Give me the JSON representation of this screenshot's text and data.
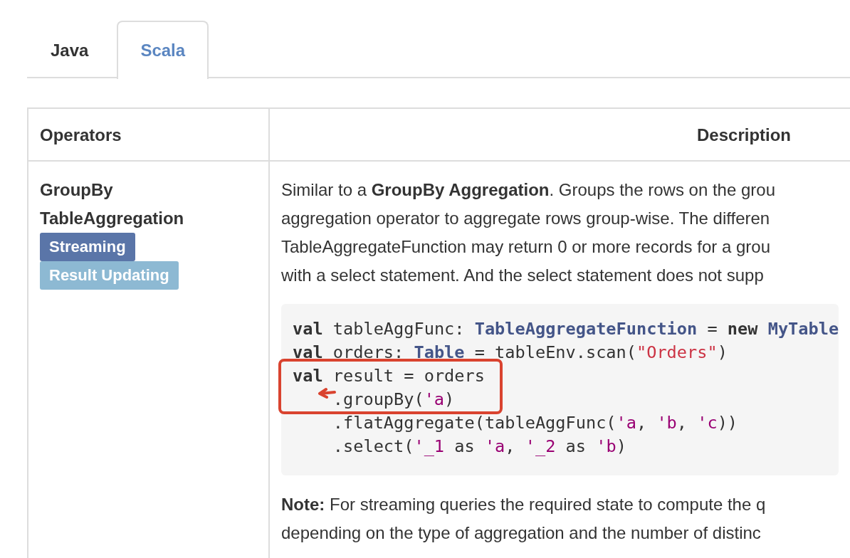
{
  "tabs": [
    {
      "label": "Java",
      "selected": false
    },
    {
      "label": "Scala",
      "selected": true
    }
  ],
  "table": {
    "columns": [
      "Operators",
      "Description"
    ],
    "rows": [
      {
        "operator": [
          "GroupBy",
          "TableAggregation"
        ],
        "tags": [
          {
            "label": "Streaming",
            "color": "#5a75a8"
          },
          {
            "label": "Result Updating",
            "color": "#8db9d3"
          }
        ],
        "description": [
          "Similar to a **GroupBy Aggregation**. Groups the rows on the grou",
          "aggregation operator to aggregate rows group-wise. The differen",
          "TableAggregateFunction may return 0 or more records for a grou",
          "with a select statement. And the select statement does not supp"
        ],
        "code": [
          {
            "indent": false,
            "tokens": [
              {
                "kind": "keyword",
                "text": "val"
              },
              {
                "kind": "plain",
                "text": " tableAggFunc: "
              },
              {
                "kind": "type",
                "text": "TableAggregateFunction"
              },
              {
                "kind": "plain",
                "text": " = "
              },
              {
                "kind": "keyword",
                "text": "new "
              },
              {
                "kind": "type",
                "text": "MyTable"
              }
            ]
          },
          {
            "indent": false,
            "tokens": [
              {
                "kind": "keyword",
                "text": "val"
              },
              {
                "kind": "plain",
                "text": " orders: "
              },
              {
                "kind": "type",
                "text": "Table"
              },
              {
                "kind": "plain",
                "text": " = tableEnv.scan("
              },
              {
                "kind": "string",
                "text": "\"Orders\""
              },
              {
                "kind": "plain",
                "text": ")"
              }
            ]
          },
          {
            "indent": false,
            "tokens": [
              {
                "kind": "keyword",
                "text": "val"
              },
              {
                "kind": "plain",
                "text": " result = orders"
              }
            ]
          },
          {
            "indent": true,
            "tokens": [
              {
                "kind": "plain",
                "text": ".groupBy("
              },
              {
                "kind": "symbol",
                "text": "'a"
              },
              {
                "kind": "plain",
                "text": ")"
              }
            ]
          },
          {
            "indent": true,
            "tokens": [
              {
                "kind": "plain",
                "text": ".flatAggregate(tableAggFunc("
              },
              {
                "kind": "symbol",
                "text": "'a"
              },
              {
                "kind": "plain",
                "text": ", "
              },
              {
                "kind": "symbol",
                "text": "'b"
              },
              {
                "kind": "plain",
                "text": ", "
              },
              {
                "kind": "symbol",
                "text": "'c"
              },
              {
                "kind": "plain",
                "text": "))"
              }
            ]
          },
          {
            "indent": true,
            "tokens": [
              {
                "kind": "plain",
                "text": ".select("
              },
              {
                "kind": "symbol",
                "text": "'_1"
              },
              {
                "kind": "plain",
                "text": " as "
              },
              {
                "kind": "symbol",
                "text": "'a"
              },
              {
                "kind": "plain",
                "text": ", "
              },
              {
                "kind": "symbol",
                "text": "'_2"
              },
              {
                "kind": "plain",
                "text": " as "
              },
              {
                "kind": "symbol",
                "text": "'b"
              },
              {
                "kind": "plain",
                "text": ")"
              }
            ]
          }
        ],
        "annotation": {
          "kind": "box-with-arrow"
        },
        "note": [
          "**Note:** For streaming queries the required state to compute the q",
          "depending on the type of aggregation and the number of distinc"
        ]
      }
    ]
  }
}
